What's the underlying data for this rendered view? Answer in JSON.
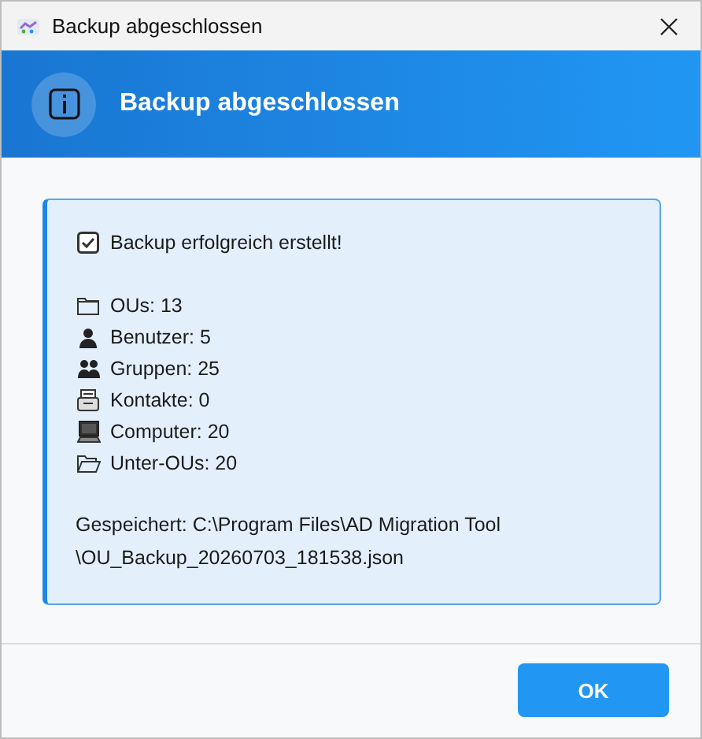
{
  "window": {
    "title": "Backup abgeschlossen"
  },
  "header": {
    "title": "Backup abgeschlossen"
  },
  "message": {
    "status": "Backup erfolgreich erstellt!",
    "checked": true,
    "items": [
      {
        "kind": "folder",
        "text": "OUs: 13"
      },
      {
        "kind": "user",
        "text": "Benutzer: 5"
      },
      {
        "kind": "group",
        "text": "Gruppen: 25"
      },
      {
        "kind": "contact",
        "text": "Kontakte: 0"
      },
      {
        "kind": "computer",
        "text": "Computer: 20"
      },
      {
        "kind": "open-folder",
        "text": "Unter-OUs: 20"
      }
    ],
    "saved_lines": [
      "Gespeichert: C:\\Program Files\\AD Migration Tool",
      "\\OU_Backup_20260703_181538.json"
    ]
  },
  "buttons": [
    "OK"
  ]
}
